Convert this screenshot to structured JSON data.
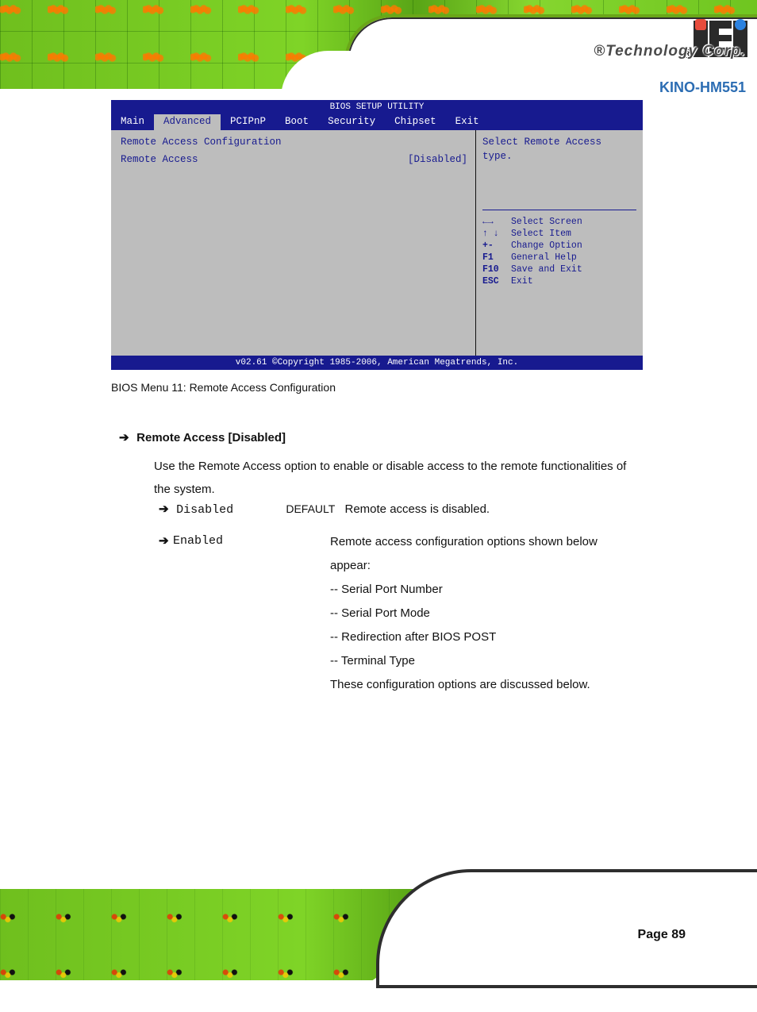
{
  "header": {
    "brand_tagline": "®Technology Corp.",
    "document_title": "KINO-HM551"
  },
  "bios": {
    "utility_title": "BIOS SETUP UTILITY",
    "tabs": [
      "Main",
      "Advanced",
      "PCIPnP",
      "Boot",
      "Security",
      "Chipset",
      "Exit"
    ],
    "active_tab": "Advanced",
    "section_heading": "Remote Access Configuration",
    "rows": [
      {
        "label": "Remote Access",
        "value": "[Disabled]"
      }
    ],
    "right_hint_lines": [
      "Select Remote Access",
      "type."
    ],
    "help": [
      {
        "sym": "←→",
        "text": "Select Screen"
      },
      {
        "sym": "↑ ↓",
        "text": "Select Item"
      },
      {
        "sym": "+-",
        "text": "Change Option"
      },
      {
        "sym": "F1",
        "text": "General Help"
      },
      {
        "sym": "F10",
        "text": "Save and Exit"
      },
      {
        "sym": "ESC",
        "text": "Exit"
      }
    ],
    "footer": "v02.61 ©Copyright 1985-2006, American Megatrends, Inc."
  },
  "caption": "BIOS Menu 11: Remote Access Configuration",
  "option_block": {
    "title": "Remote Access [Disabled]",
    "description": "Use the Remote Access option to enable or disable access to the remote functionalities of the system.",
    "options": [
      {
        "value": "Disabled",
        "default_badge": "DEFAULT",
        "explanation": "Remote access is disabled."
      },
      {
        "value": "Enabled",
        "default_badge": "",
        "explanation_lines": [
          "Remote access configuration options shown below",
          "appear:",
          "-- Serial Port Number",
          "-- Serial Port Mode",
          "-- Redirection after BIOS POST",
          "-- Terminal Type",
          "These configuration options are discussed below."
        ]
      }
    ]
  },
  "footer": {
    "page_label": "Page 89"
  }
}
